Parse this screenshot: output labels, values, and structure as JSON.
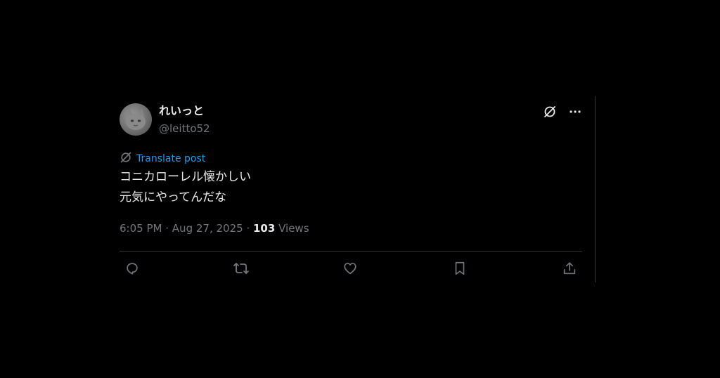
{
  "post": {
    "display_name": "れいっと",
    "handle": "@leitto52",
    "translate_label": "Translate post",
    "text_lines": [
      "コニカローレル懐かしい",
      "元気にやってんだな"
    ],
    "time": "6:05 PM",
    "separator": "·",
    "date": "Aug 27, 2025",
    "views_count": "103",
    "views_label": "Views"
  },
  "icons": {
    "grok": "grok-icon",
    "more": "more-icon",
    "translate": "translate-icon",
    "reply": "reply-icon",
    "repost": "repost-icon",
    "like": "like-icon",
    "bookmark": "bookmark-icon",
    "share": "share-icon"
  },
  "colors": {
    "background": "#000000",
    "text_primary": "#e7e9ea",
    "text_secondary": "#71767b",
    "accent": "#1d9bf0",
    "border": "#2f3336"
  }
}
